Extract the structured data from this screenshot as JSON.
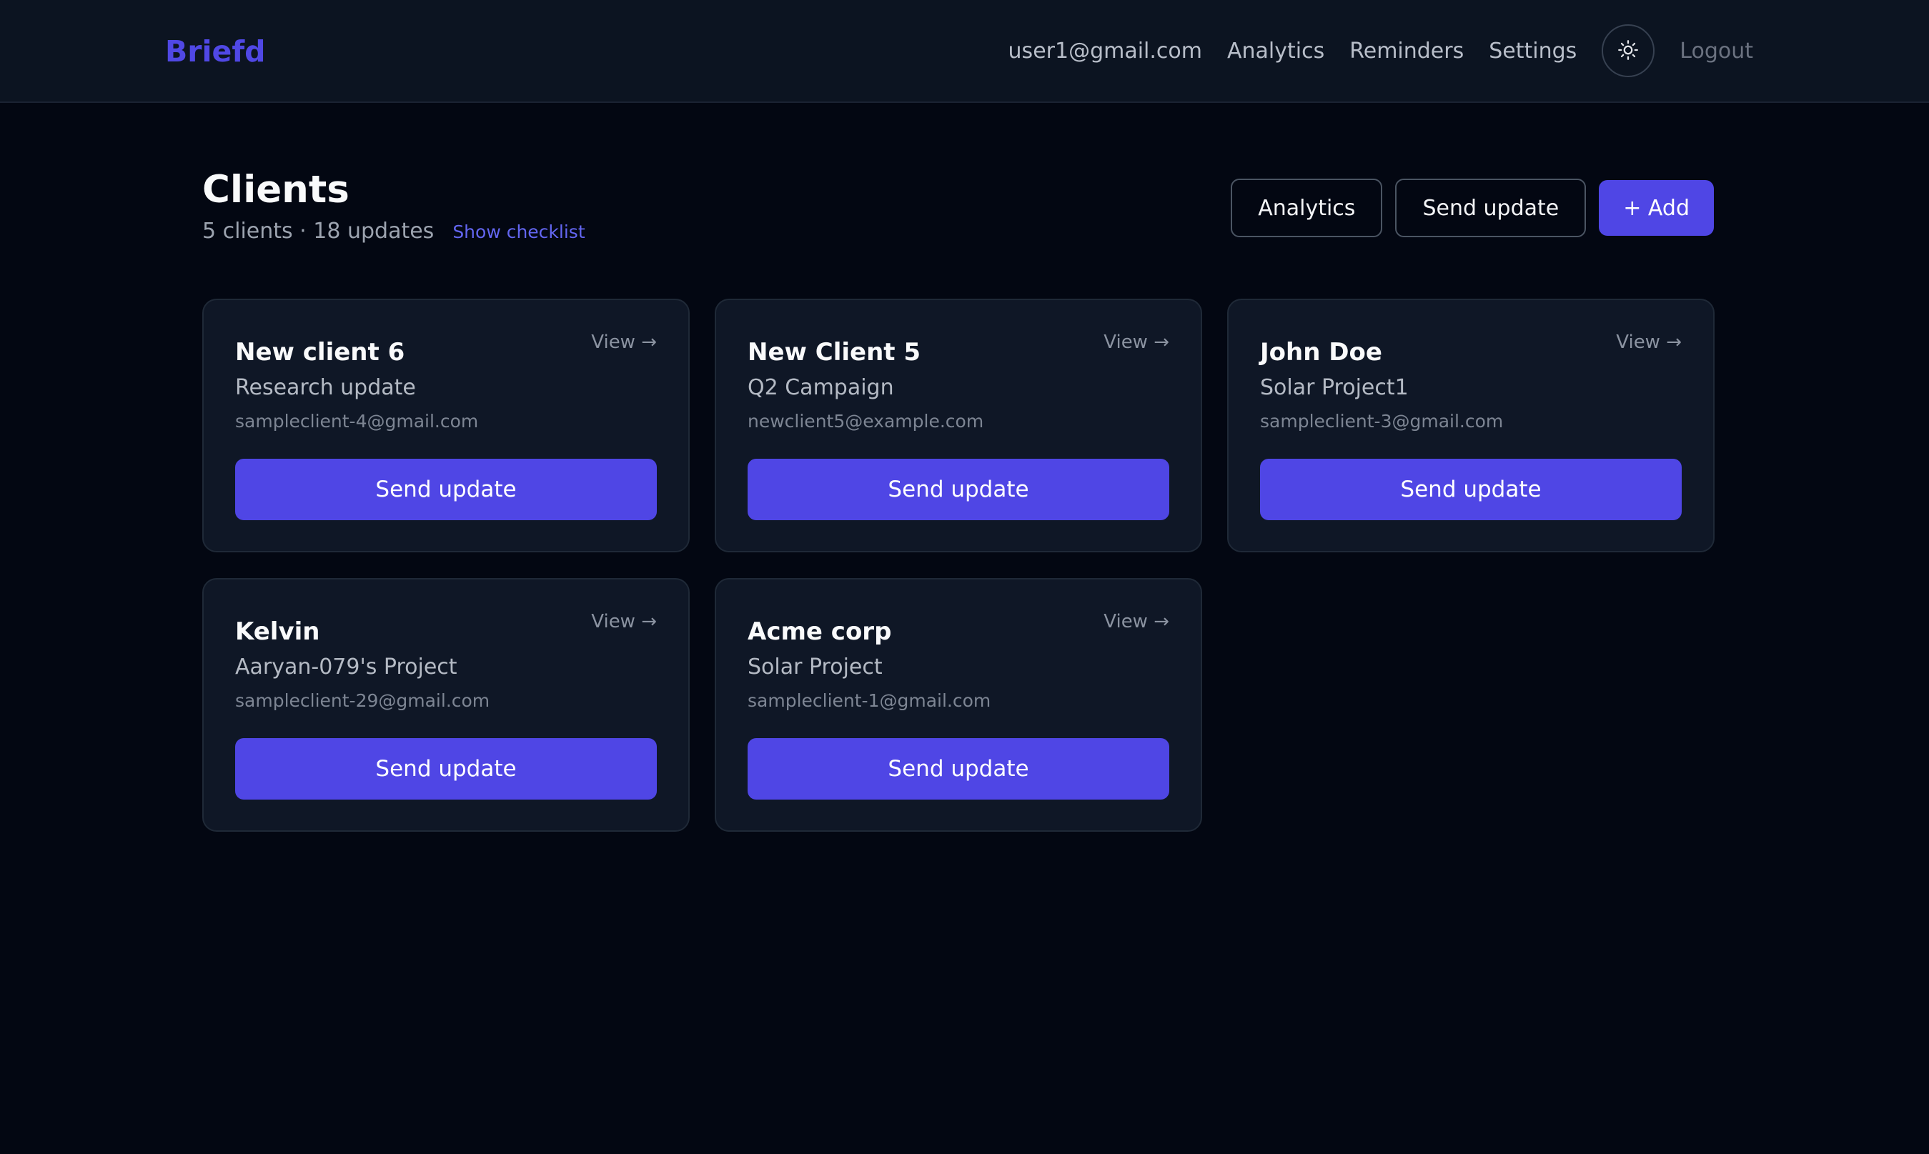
{
  "nav": {
    "brand": "Briefd",
    "user_email": "user1@gmail.com",
    "links": [
      "Analytics",
      "Reminders",
      "Settings"
    ],
    "theme_icon": "sun-icon",
    "logout": "Logout"
  },
  "header": {
    "title": "Clients",
    "counts": "5 clients · 18 updates",
    "checklist_link": "Show checklist"
  },
  "actions": {
    "analytics": "Analytics",
    "send_update": "Send update",
    "add": "+ Add"
  },
  "clients": [
    {
      "name": "New client 6",
      "project": "Research update",
      "email": "sampleclient-4@gmail.com",
      "view": "View →",
      "button": "Send update"
    },
    {
      "name": "New Client 5",
      "project": "Q2 Campaign",
      "email": "newclient5@example.com",
      "view": "View →",
      "button": "Send update"
    },
    {
      "name": "John Doe",
      "project": "Solar Project1",
      "email": "sampleclient-3@gmail.com",
      "view": "View →",
      "button": "Send update"
    },
    {
      "name": "Kelvin",
      "project": "Aaryan-079's Project",
      "email": "sampleclient-29@gmail.com",
      "view": "View →",
      "button": "Send update"
    },
    {
      "name": "Acme corp",
      "project": "Solar Project",
      "email": "sampleclient-1@gmail.com",
      "view": "View →",
      "button": "Send update"
    }
  ],
  "colors": {
    "accent": "#4f46e5",
    "brand": "#5048e5",
    "background": "#030712",
    "topbar": "#0c1421",
    "card": "#0f1726"
  }
}
